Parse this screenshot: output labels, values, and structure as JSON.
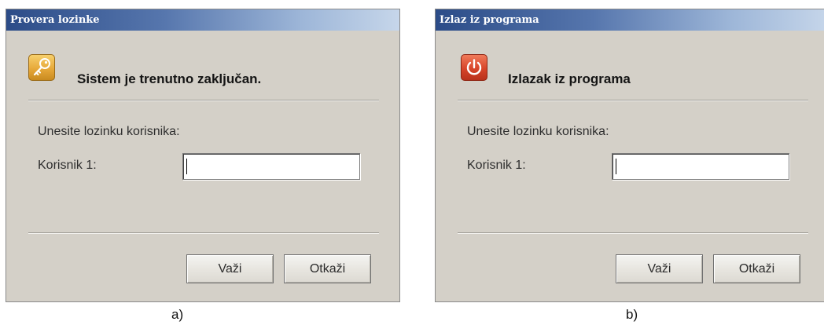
{
  "dialogs": [
    {
      "title": "Provera lozinke",
      "icon": "key-icon",
      "header": "Sistem je trenutno zaključan.",
      "prompt": "Unesite lozinku korisnika:",
      "user_label": "Korisnik 1:",
      "password_value": "",
      "ok_label": "Važi",
      "cancel_label": "Otkaži",
      "caption": "a)"
    },
    {
      "title": "Izlaz iz programa",
      "icon": "power-icon",
      "header": "Izlazak iz programa",
      "prompt": "Unesite lozinku korisnika:",
      "user_label": "Korisnik 1:",
      "password_value": "",
      "ok_label": "Važi",
      "cancel_label": "Otkaži",
      "caption": "b)"
    }
  ],
  "colors": {
    "titlebar_start": "#2c4c88",
    "titlebar_end": "#c6d6ea",
    "dialog_bg": "#d4d0c8",
    "key_icon": "#e7a93a",
    "power_icon": "#d7452a"
  }
}
